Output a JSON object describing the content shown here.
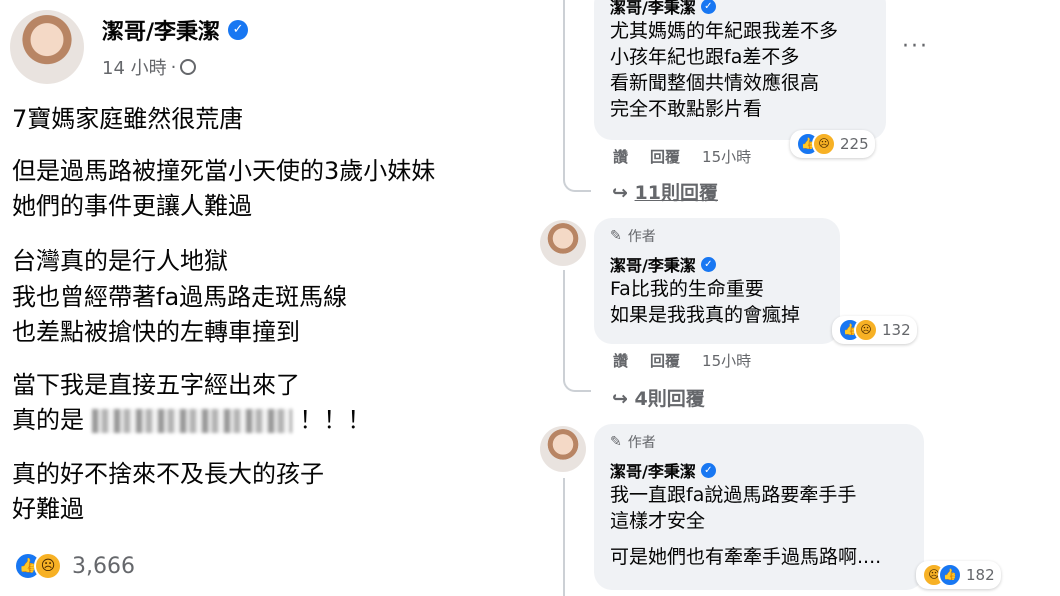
{
  "post": {
    "author": "潔哥/李秉潔",
    "time": "14 小時",
    "separator": "·",
    "lines": [
      "7寶媽家庭雖然很荒唐",
      "但是過馬路被撞死當小天使的3歲小妹妹",
      "她們的事件更讓人難過",
      "台灣真的是行人地獄",
      "我也曾經帶著fa過馬路走斑馬線",
      "也差點被搶快的左轉車撞到",
      "當下我是直接五字經出來了",
      "真的是",
      "！！！",
      "真的好不捨來不及長大的孩子",
      "好難過"
    ],
    "reaction_count": "3,666"
  },
  "comments": [
    {
      "author": "潔哥/李秉潔",
      "lines": [
        "尤其媽媽的年紀跟我差不多",
        "小孩年紀也跟fa差不多",
        "看新聞整個共情效應很高",
        "完全不敢點影片看"
      ],
      "reaction_count": "225",
      "actions": {
        "like": "讚",
        "reply": "回覆",
        "time": "15小時"
      },
      "replies": "11則回覆",
      "more": "···"
    },
    {
      "badge": "作者",
      "author": "潔哥/李秉潔",
      "lines": [
        "Fa比我的生命重要",
        "如果是我我真的會瘋掉"
      ],
      "reaction_count": "132",
      "actions": {
        "like": "讚",
        "reply": "回覆",
        "time": "15小時"
      },
      "replies": "4則回覆"
    },
    {
      "badge": "作者",
      "author": "潔哥/李秉潔",
      "lines": [
        "我一直跟fa說過馬路要牽手手",
        "這樣才安全",
        "可是她們也有牽牽手過馬路啊...."
      ],
      "reaction_count": "182"
    }
  ],
  "icons": {
    "verified": "verified-check-icon",
    "globe": "globe-icon",
    "like": "like-reaction-icon",
    "sad": "sad-reaction-icon",
    "reply_arrow": "reply-arrow-icon",
    "pen": "pen-icon",
    "more": "more-options-icon"
  },
  "colors": {
    "accent": "#1877f2",
    "bubble": "#f0f2f5",
    "muted": "#65676b"
  }
}
